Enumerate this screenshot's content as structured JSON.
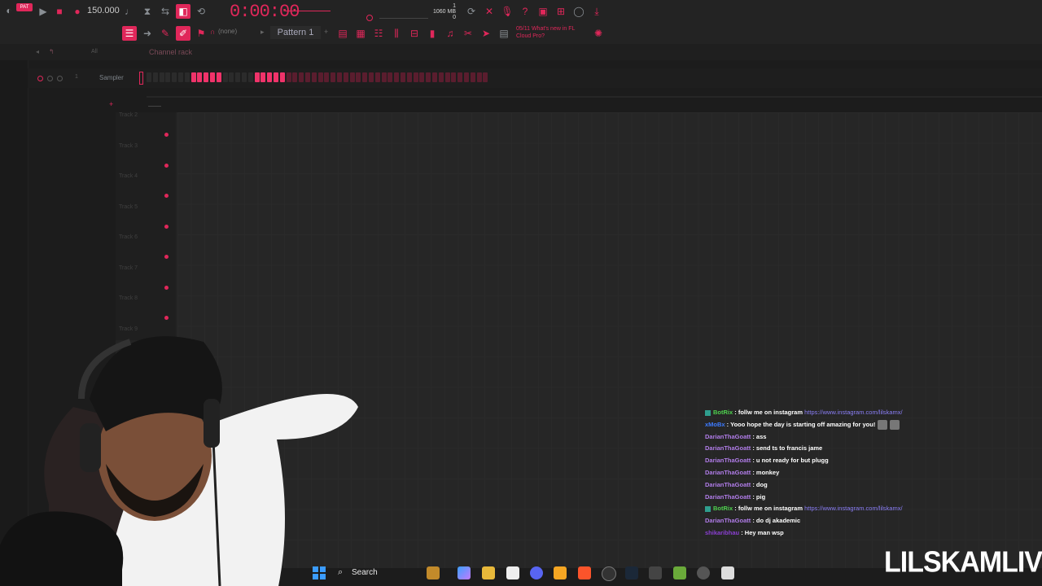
{
  "toolbar": {
    "tempo": "150.000",
    "time": "0:00:00",
    "memory": [
      "1",
      "1060 MB",
      "0"
    ],
    "pattern_name": "Pattern 1",
    "snap": "(none)",
    "news": "05/11  What's new in FL Cloud Pro?"
  },
  "browser": {
    "all_label": "All",
    "channel_rack_title": "Channel rack"
  },
  "channel_rack": {
    "channel_number": "1",
    "channel_name": "Sampler"
  },
  "playlist": {
    "tracks": [
      "Track 2",
      "Track 3",
      "Track 4",
      "Track 5",
      "Track 6",
      "Track 7",
      "Track 8",
      "Track 9"
    ]
  },
  "chat": {
    "messages": [
      {
        "user": "BotRix",
        "user_color": "#4ed14e",
        "text": ": follw me on instagram ",
        "link": "https://www.instagram.com/lilskamx/",
        "badge": true
      },
      {
        "user": "xMoBx",
        "user_color": "#3d7bff",
        "text": ": Yooo hope the day is starting off amazing for you!",
        "link": "",
        "emotes": 2
      },
      {
        "user": "DarianThaGoatt",
        "user_color": "#b07ce8",
        "text": ": ass",
        "link": ""
      },
      {
        "user": "DarianThaGoatt",
        "user_color": "#b07ce8",
        "text": ": send ts to francis jame",
        "link": ""
      },
      {
        "user": "DarianThaGoatt",
        "user_color": "#b07ce8",
        "text": ": u not ready for but plugg",
        "link": ""
      },
      {
        "user": "DarianThaGoatt",
        "user_color": "#b07ce8",
        "text": ": monkey",
        "link": ""
      },
      {
        "user": "DarianThaGoatt",
        "user_color": "#b07ce8",
        "text": ": dog",
        "link": ""
      },
      {
        "user": "DarianThaGoatt",
        "user_color": "#b07ce8",
        "text": ": pig",
        "link": ""
      },
      {
        "user": "BotRix",
        "user_color": "#4ed14e",
        "text": ": follw me on instagram ",
        "link": "https://www.instagram.com/lilskamx/",
        "badge": true
      },
      {
        "user": "DarianThaGoatt",
        "user_color": "#b07ce8",
        "text": ": do dj akademic",
        "link": ""
      },
      {
        "user": "shikaribhau",
        "user_color": "#8a3fd1",
        "text": ": Hey man wsp",
        "link": ""
      }
    ]
  },
  "taskbar": {
    "search_label": "Search"
  },
  "watermark": "LILSKAMLIVE"
}
